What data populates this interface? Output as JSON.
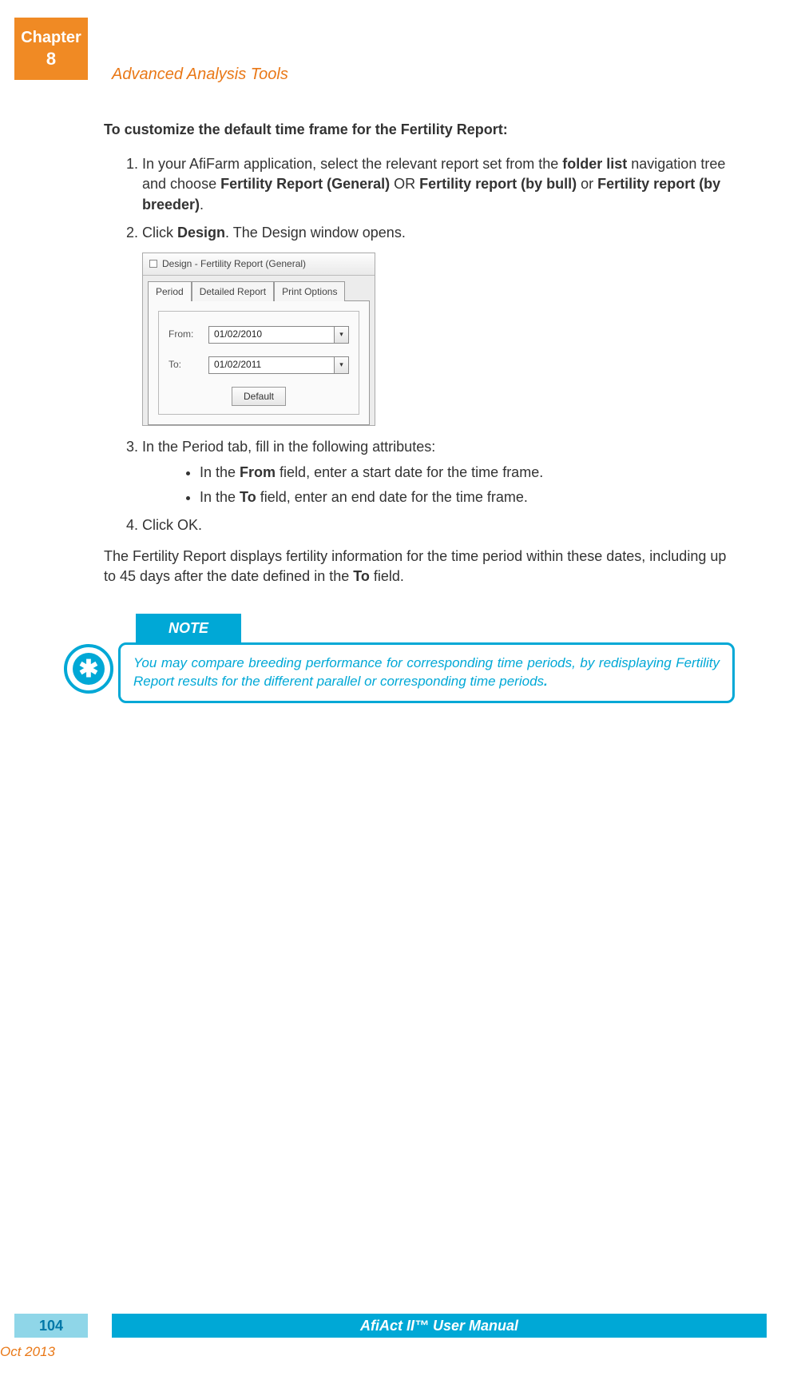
{
  "chapter": {
    "label": "Chapter",
    "number": "8"
  },
  "header_section": "Advanced Analysis Tools",
  "heading": "To customize the default time frame for the Fertility Report:",
  "steps": {
    "s1_a": "In your AfiFarm application, select the relevant report set from the ",
    "s1_b1": "folder list",
    "s1_c": " navigation tree and choose ",
    "s1_b2": "Fertility Report (General)",
    "s1_d": " OR ",
    "s1_b3": "Fertility report (by bull)",
    "s1_e": " or ",
    "s1_b4": "Fertility report (by breeder)",
    "s1_f": ".",
    "s2_a": "Click ",
    "s2_b": "Design",
    "s2_c": ". The Design window opens.",
    "s3": "In the Period tab, fill in the following attributes:",
    "s3b1_a": "In the ",
    "s3b1_b": "From",
    "s3b1_c": " field, enter a start date for the time frame.",
    "s3b2_a": "In the ",
    "s3b2_b": "To",
    "s3b2_c": " field, enter an end date for the time frame.",
    "s4": "Click OK."
  },
  "result_a": "The Fertility Report displays fertility information for the time period within these dates, including up to 45 days after the date defined in the ",
  "result_b": "To",
  "result_c": " field.",
  "dialog": {
    "title": "Design - Fertility Report (General)",
    "tabs": {
      "t1": "Period",
      "t2": "Detailed Report",
      "t3": "Print Options"
    },
    "from_label": "From:",
    "from_value": "01/02/2010",
    "to_label": "To:",
    "to_value": "01/02/2011",
    "default_btn": "Default"
  },
  "note": {
    "label": "NOTE",
    "text_a": "You may compare breeding performance for corresponding time periods, by redisplaying Fertility Report results for the different parallel or corresponding time periods",
    "text_b": "."
  },
  "footer": {
    "page": "104",
    "title": "AfiAct II™ User Manual",
    "date": "Oct 2013"
  }
}
